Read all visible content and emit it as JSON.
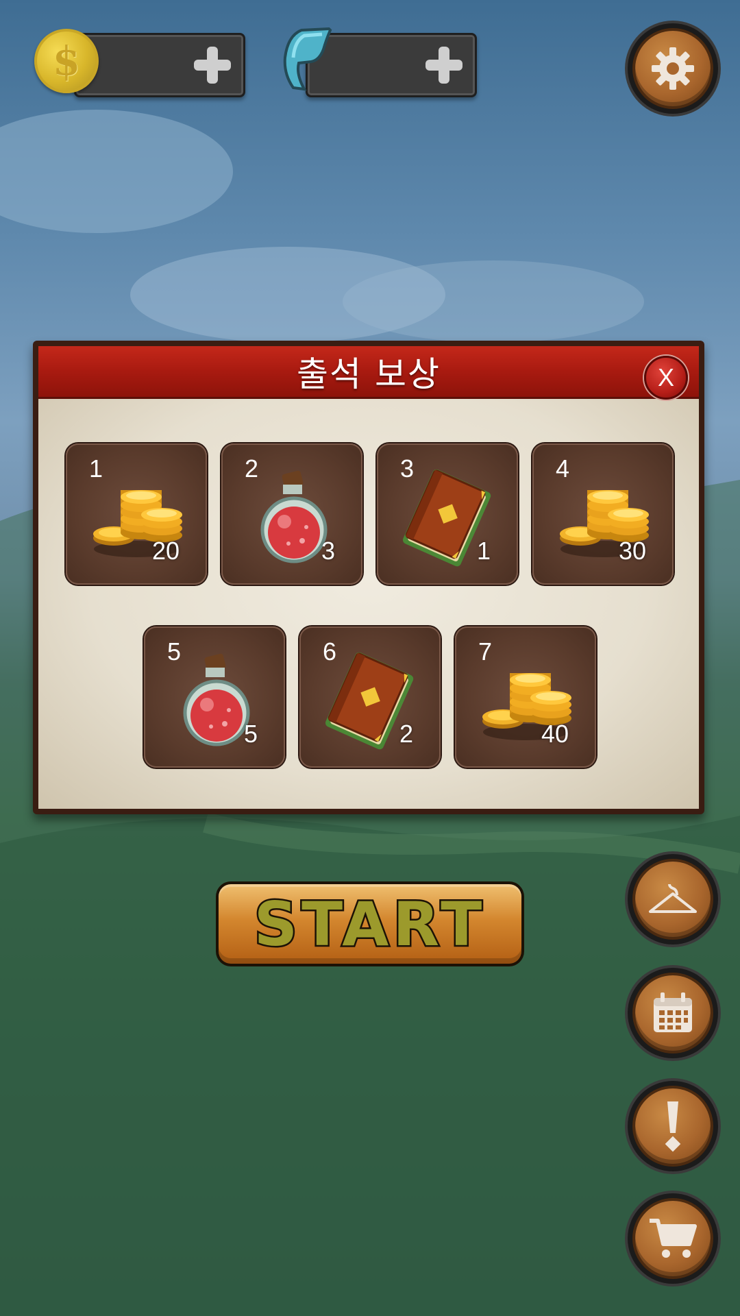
{
  "hud": {
    "coin_icon_glyph": "$",
    "coin_value": "",
    "energy_value": "",
    "coin_plus_icon": "plus-icon",
    "energy_plus_icon": "plus-icon"
  },
  "dialog": {
    "title": "출석 보상",
    "close_label": "X",
    "rewards": [
      {
        "day": "1",
        "qty": "20",
        "item": "gold-coins"
      },
      {
        "day": "2",
        "qty": "3",
        "item": "red-potion"
      },
      {
        "day": "3",
        "qty": "1",
        "item": "spell-book"
      },
      {
        "day": "4",
        "qty": "30",
        "item": "gold-coins"
      },
      {
        "day": "5",
        "qty": "5",
        "item": "red-potion"
      },
      {
        "day": "6",
        "qty": "2",
        "item": "spell-book"
      },
      {
        "day": "7",
        "qty": "40",
        "item": "gold-coins"
      }
    ]
  },
  "start_button": {
    "label": "START"
  },
  "side_menu": [
    "settings-icon",
    "hanger-icon",
    "calendar-icon",
    "exclamation-icon",
    "cart-icon"
  ],
  "colors": {
    "dialog_header": "#b0200f",
    "slot_bg": "#5a3b2c",
    "button_wood": "#a9662d"
  }
}
